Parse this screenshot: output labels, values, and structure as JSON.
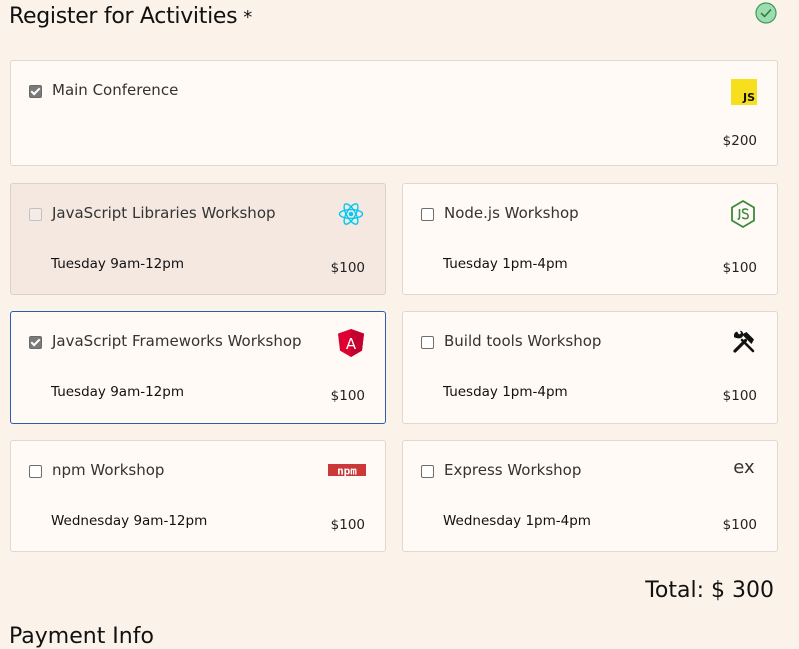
{
  "heading": "Register for Activities",
  "required_mark": "*",
  "main": {
    "title": "Main Conference",
    "price": "$200",
    "checked": true,
    "icon": "javascript-logo-icon",
    "icon_text": "JS"
  },
  "workshops": [
    {
      "title": "JavaScript Libraries Workshop",
      "time": "Tuesday 9am-12pm",
      "price": "$100",
      "checked": false,
      "disabled": true,
      "icon": "react-logo-icon"
    },
    {
      "title": "Node.js Workshop",
      "time": "Tuesday 1pm-4pm",
      "price": "$100",
      "checked": false,
      "disabled": false,
      "icon": "nodejs-logo-icon"
    },
    {
      "title": "JavaScript Frameworks Workshop",
      "time": "Tuesday 9am-12pm",
      "price": "$100",
      "checked": true,
      "disabled": false,
      "icon": "angular-logo-icon",
      "icon_text": "A"
    },
    {
      "title": "Build tools Workshop",
      "time": "Tuesday 1pm-4pm",
      "price": "$100",
      "checked": false,
      "disabled": false,
      "icon": "tools-icon"
    },
    {
      "title": "npm Workshop",
      "time": "Wednesday 9am-12pm",
      "price": "$100",
      "checked": false,
      "disabled": false,
      "icon": "npm-logo-icon",
      "icon_text": "npm"
    },
    {
      "title": "Express Workshop",
      "time": "Wednesday 1pm-4pm",
      "price": "$100",
      "checked": false,
      "disabled": false,
      "icon": "express-logo-icon",
      "icon_text": "ex"
    }
  ],
  "total": "Total: $ 300",
  "next_section_heading": "Payment Info",
  "colors": {
    "background": "#fbf2ea",
    "card": "#fffaf5",
    "disabled_card": "#f5e8e1",
    "focus_border": "#2c5fa8",
    "valid_green": "#8fd6a0"
  }
}
